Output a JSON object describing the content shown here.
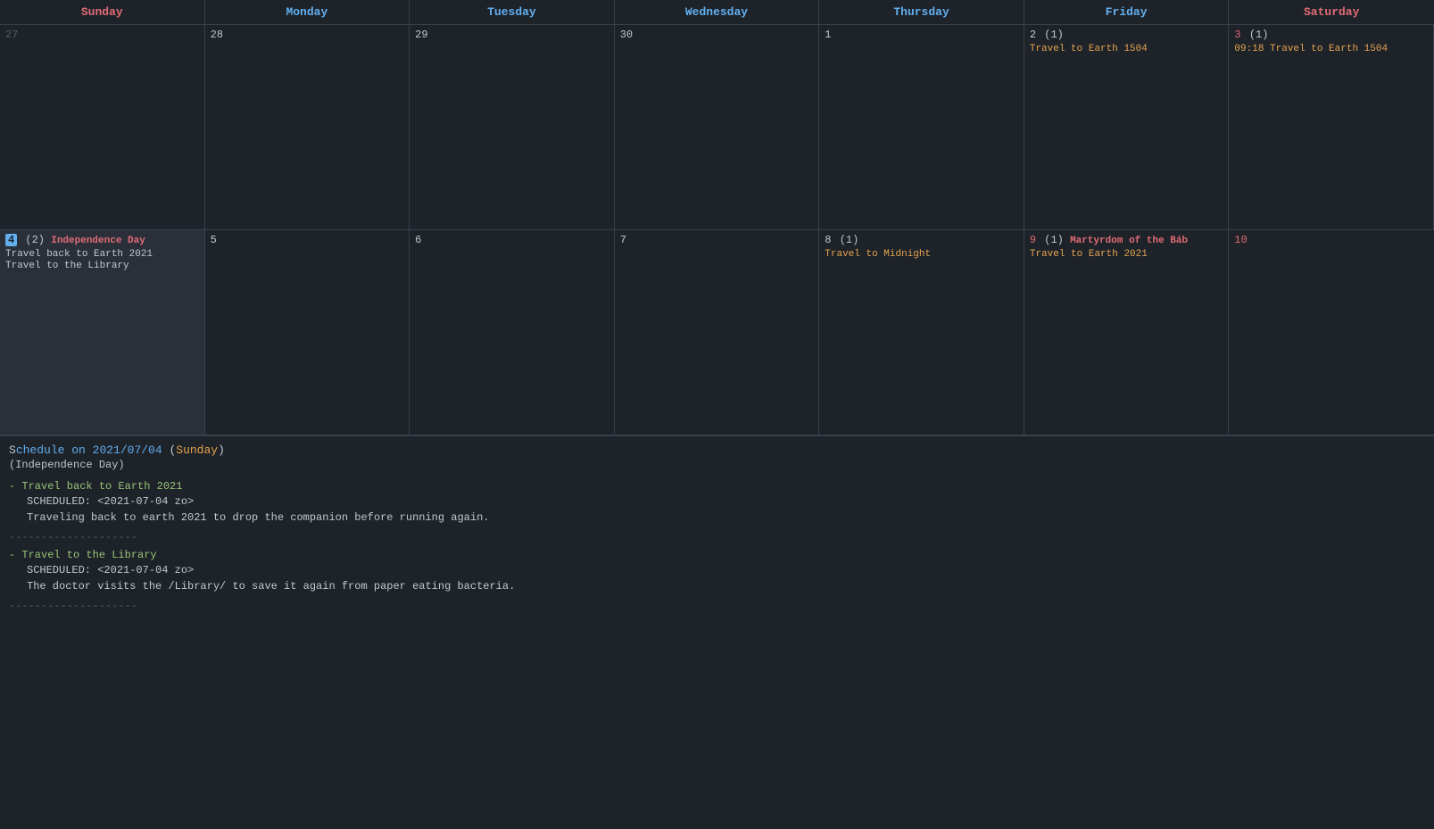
{
  "calendar": {
    "headers": [
      {
        "label": "Sunday",
        "class": "col-sun"
      },
      {
        "label": "Monday",
        "class": "col-mon"
      },
      {
        "label": "Tuesday",
        "class": "col-tue"
      },
      {
        "label": "Wednesday",
        "class": "col-wed"
      },
      {
        "label": "Thursday",
        "class": "col-thu"
      },
      {
        "label": "Friday",
        "class": "col-fri"
      },
      {
        "label": "Saturday",
        "class": "col-sat"
      }
    ],
    "rows": [
      [
        {
          "date": "27",
          "otherMonth": true,
          "events": []
        },
        {
          "date": "28",
          "otherMonth": false,
          "events": []
        },
        {
          "date": "29",
          "otherMonth": false,
          "events": []
        },
        {
          "date": "30",
          "otherMonth": false,
          "events": []
        },
        {
          "date": "1",
          "otherMonth": false,
          "events": []
        },
        {
          "date": "2",
          "otherMonth": false,
          "count": "(1)",
          "events": [
            {
              "text": "Travel to Earth 1504",
              "type": "orange"
            }
          ]
        },
        {
          "date": "3",
          "otherMonth": false,
          "red": true,
          "count": "(1)",
          "events": [
            {
              "text": "09:18 Travel to Earth 1504",
              "type": "orange"
            }
          ]
        }
      ],
      [
        {
          "date": "4",
          "otherMonth": false,
          "selected": true,
          "count": "(2)",
          "holiday": "Independence Day",
          "events": [
            {
              "text": "Travel back to Earth 2021",
              "type": "white"
            },
            {
              "text": "Travel to the Library",
              "type": "white"
            }
          ]
        },
        {
          "date": "5",
          "otherMonth": false,
          "events": []
        },
        {
          "date": "6",
          "otherMonth": false,
          "events": []
        },
        {
          "date": "7",
          "otherMonth": false,
          "events": []
        },
        {
          "date": "8",
          "otherMonth": false,
          "count": "(1)",
          "events": [
            {
              "text": "Travel to Midnight",
              "type": "orange"
            }
          ]
        },
        {
          "date": "9",
          "otherMonth": false,
          "red": true,
          "count": "(1)",
          "holiday": "Martyrdom of the Báb",
          "events": [
            {
              "text": "Travel to Earth 2021",
              "type": "orange"
            }
          ]
        },
        {
          "date": "10",
          "otherMonth": false,
          "red": true,
          "events": []
        }
      ]
    ]
  },
  "schedule": {
    "title": "Schedule on 2021/07/04 (Sunday)",
    "subtitle": "(Independence Day)",
    "entries": [
      {
        "bullet": "- Travel back to Earth 2021",
        "scheduled": "SCHEDULED: <2021-07-04 zo>",
        "description": "Traveling back to earth 2021 to drop the companion before running again."
      },
      {
        "bullet": "- Travel to the Library",
        "scheduled": "SCHEDULED: <2021-07-04 zo>",
        "description": "The doctor visits the /Library/ to save it again from paper eating bacteria."
      }
    ],
    "divider": "--------------------"
  }
}
